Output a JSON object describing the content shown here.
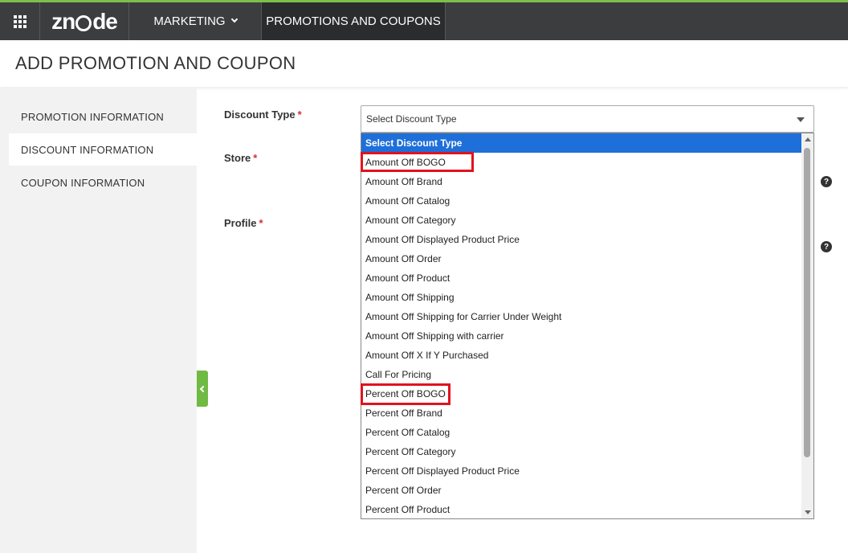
{
  "topbar": {
    "logo": "znode",
    "nav_marketing": "MARKETING",
    "nav_promotions": "PROMOTIONS AND COUPONS",
    "accent_color": "#7cc04b"
  },
  "page": {
    "title": "ADD PROMOTION AND COUPON"
  },
  "sidebar": {
    "items": [
      {
        "label": "PROMOTION INFORMATION"
      },
      {
        "label": "DISCOUNT INFORMATION"
      },
      {
        "label": "COUPON INFORMATION"
      }
    ]
  },
  "form": {
    "discount_type_label": "Discount Type",
    "store_label": "Store",
    "profile_label": "Profile",
    "required_mark": "*",
    "discount_type_selected": "Select Discount Type",
    "help_icon": "?"
  },
  "dropdown": {
    "options": [
      "Select Discount Type",
      "Amount Off BOGO",
      "Amount Off Brand",
      "Amount Off Catalog",
      "Amount Off Category",
      "Amount Off Displayed Product Price",
      "Amount Off Order",
      "Amount Off Product",
      "Amount Off Shipping",
      "Amount Off Shipping for Carrier Under Weight",
      "Amount Off Shipping with carrier",
      "Amount Off X If Y Purchased",
      "Call For Pricing",
      "Percent Off BOGO",
      "Percent Off Brand",
      "Percent Off Catalog",
      "Percent Off Category",
      "Percent Off Displayed Product Price",
      "Percent Off Order",
      "Percent Off Product"
    ],
    "highlight_color": "#e0131f",
    "selected_color": "#1e6fd9"
  }
}
